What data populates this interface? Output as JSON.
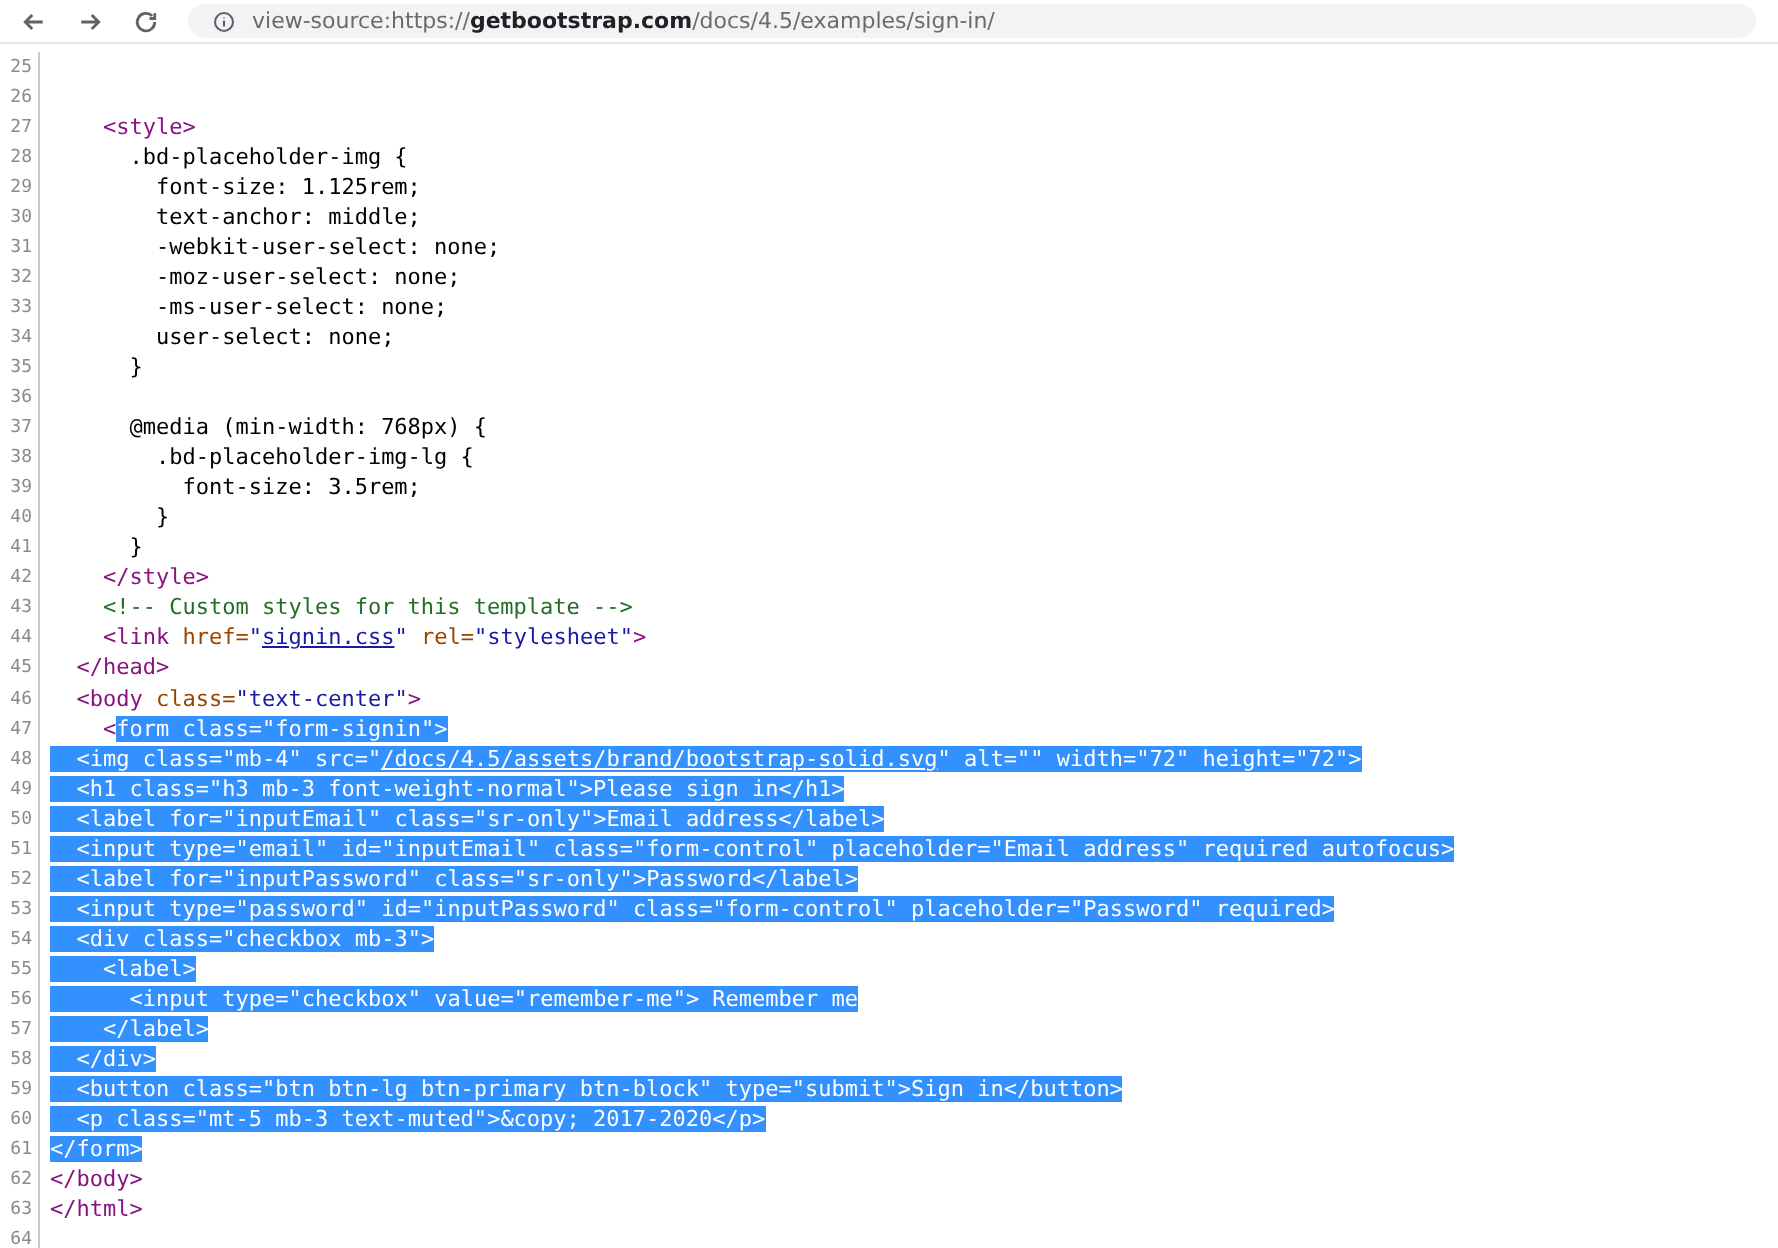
{
  "address_bar": {
    "url": "view-source:https://**getbootstrap.com**/docs/4.5/examples/sign-in/"
  },
  "lines": [
    {
      "number": "25"
    },
    {
      "number": "26"
    },
    {
      "number": "27",
      "segments": [
        {
          "text": "    <style>",
          "selected": false
        }
      ]
    },
    {
      "number": "28",
      "segments": [
        {
          "text": "      .bd-placeholder-img {",
          "selected": false
        }
      ]
    },
    {
      "number": "29",
      "segments": [
        {
          "text": "        font-size: 1.125rem;",
          "selected": false
        }
      ]
    },
    {
      "number": "30",
      "segments": [
        {
          "text": "        text-anchor: middle;",
          "selected": false
        }
      ]
    },
    {
      "number": "31",
      "segments": [
        {
          "text": "        -webkit-user-select: none;",
          "selected": false
        }
      ]
    },
    {
      "number": "32",
      "segments": [
        {
          "text": "        -moz-user-select: none;",
          "selected": false
        }
      ]
    },
    {
      "number": "33",
      "segments": [
        {
          "text": "        -ms-user-select: none;",
          "selected": false
        }
      ]
    },
    {
      "number": "34",
      "segments": [
        {
          "text": "        user-select: none;",
          "selected": false
        }
      ]
    },
    {
      "number": "35",
      "segments": [
        {
          "text": "      }",
          "selected": false
        }
      ]
    },
    {
      "number": "36"
    },
    {
      "number": "37",
      "segments": [
        {
          "text": "      @media (min-width: 768px) {",
          "selected": false
        }
      ]
    },
    {
      "number": "38",
      "segments": [
        {
          "text": "        .bd-placeholder-img-lg {",
          "selected": false
        }
      ]
    },
    {
      "number": "39",
      "segments": [
        {
          "text": "          font-size: 3.5rem;",
          "selected": false
        }
      ]
    },
    {
      "number": "40",
      "segments": [
        {
          "text": "        }",
          "selected": false
        }
      ]
    },
    {
      "number": "41",
      "segments": [
        {
          "text": "      }",
          "selected": false
        }
      ]
    },
    {
      "number": "42",
      "segments": [
        {
          "text": "    </style>",
          "selected": false
        }
      ]
    },
    {
      "number": "43",
      "segments": [
        {
          "text": "    <!-- Custom styles for this template -->",
          "selected": false
        }
      ]
    },
    {
      "number": "44",
      "segments": [
        {
          "text": "    <link href=\"",
          "selected": false
        },
        {
          "text": "signin.css",
          "selected": false,
          "kind": "link"
        },
        {
          "text": "\" rel=\"stylesheet\">",
          "selected": false
        }
      ]
    },
    {
      "number": "45",
      "segments": [
        {
          "text": "  </head>",
          "selected": false
        }
      ]
    },
    {
      "number": "46",
      "segments": [
        {
          "text": "  <body class=\"text-center\">",
          "selected": false
        }
      ]
    },
    {
      "number": "47",
      "segments": [
        {
          "text": "    <",
          "selected": false
        },
        {
          "text": "form class=\"form-signin\">",
          "selected": true
        }
      ]
    },
    {
      "number": "48",
      "segments": [
        {
          "text": "  <img class=\"mb-4\" src=\"",
          "selected": true
        },
        {
          "text": "/docs/4.5/assets/brand/bootstrap-solid.svg",
          "selected": true,
          "kind": "link"
        },
        {
          "text": "\" alt=\"\" width=\"72\" height=\"72\">",
          "selected": true
        }
      ]
    },
    {
      "number": "49",
      "segments": [
        {
          "text": "  <h1 class=\"h3 mb-3 font-weight-normal\">Please sign in</h1>",
          "selected": true
        }
      ]
    },
    {
      "number": "50",
      "segments": [
        {
          "text": "  <label for=\"inputEmail\" class=\"sr-only\">Email address</label>",
          "selected": true
        }
      ]
    },
    {
      "number": "51",
      "segments": [
        {
          "text": "  <input type=\"email\" id=\"inputEmail\" class=\"form-control\" placeholder=\"Email address\" required autofocus>",
          "selected": true
        }
      ]
    },
    {
      "number": "52",
      "segments": [
        {
          "text": "  <label for=\"inputPassword\" class=\"sr-only\">Password</label>",
          "selected": true
        }
      ]
    },
    {
      "number": "53",
      "segments": [
        {
          "text": "  <input type=\"password\" id=\"inputPassword\" class=\"form-control\" placeholder=\"Password\" required>",
          "selected": true
        }
      ]
    },
    {
      "number": "54",
      "segments": [
        {
          "text": "  <div class=\"checkbox mb-3\">",
          "selected": true
        }
      ]
    },
    {
      "number": "55",
      "segments": [
        {
          "text": "    <label>",
          "selected": true
        }
      ]
    },
    {
      "number": "56",
      "segments": [
        {
          "text": "      <input type=\"checkbox\" value=\"remember-me\"> Remember me",
          "selected": true
        }
      ]
    },
    {
      "number": "57",
      "segments": [
        {
          "text": "    </label>",
          "selected": true
        }
      ]
    },
    {
      "number": "58",
      "segments": [
        {
          "text": "  </div>",
          "selected": true
        }
      ]
    },
    {
      "number": "59",
      "segments": [
        {
          "text": "  <button class=\"btn btn-lg btn-primary btn-block\" type=\"submit\">Sign in</button>",
          "selected": true
        }
      ]
    },
    {
      "number": "60",
      "segments": [
        {
          "text": "  <p class=\"mt-5 mb-3 text-muted\">&copy; 2017-2020</p>",
          "selected": true
        }
      ]
    },
    {
      "number": "61",
      "segments": [
        {
          "text": "</form>",
          "selected": true
        }
      ]
    },
    {
      "number": "62",
      "segments": [
        {
          "text": "</body>",
          "selected": false
        }
      ]
    },
    {
      "number": "63",
      "segments": [
        {
          "text": "</html>",
          "selected": false
        }
      ]
    },
    {
      "number": "64"
    }
  ]
}
